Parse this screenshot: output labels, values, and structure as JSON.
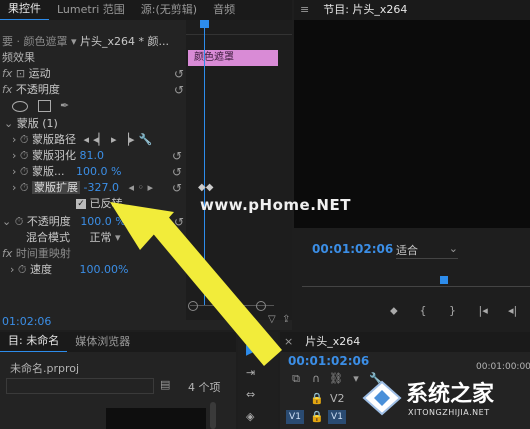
{
  "effect_controls": {
    "tabs": [
      "果控件",
      "Lumetri 范围",
      "源:(无剪辑)",
      "音频"
    ],
    "source_clip": "要 · 颜色遮罩",
    "target_clip": "片头_x264 * 颜...",
    "section_video_effects": "频效果",
    "motion": "运动",
    "opacity": "不透明度",
    "mask_group": "蒙版 (1)",
    "mask_path": "蒙版路径",
    "mask_feather": "蒙版羽化",
    "mask_feather_value": "81.0",
    "mask_opacity": "蒙版...",
    "mask_opacity_value": "100.0 %",
    "mask_expansion": "蒙版扩展",
    "mask_expansion_value": "-327.0",
    "inverted": "已反转",
    "opacity_label": "不透明度",
    "opacity_value": "100.0 %",
    "blend_mode": "混合模式",
    "blend_value": "正常",
    "time_remap": "时间重映射",
    "speed": "速度",
    "speed_value": "100.00%",
    "clip_bar_label": "颜色遮罩",
    "timecode": "01:02:06",
    "fx": "fx"
  },
  "program_monitor": {
    "title": "节目: 片头_x264",
    "timecode": "00:01:02:06",
    "fit": "适合"
  },
  "project": {
    "tabs": [
      "目: 未命名",
      "媒体浏览器"
    ],
    "file": "未命名.prproj",
    "count": "4 个项"
  },
  "timeline": {
    "title": "片头_x264",
    "timecode": "00:01:02:06",
    "ruler_time": "00:01:00:00",
    "tracks": [
      "V2",
      "V1"
    ]
  },
  "watermark": {
    "url": "www.pHome.NET",
    "brand": "系统之家",
    "brand_url": "XITONGZHIJIA.NET"
  },
  "colors": {
    "accent": "#2d8ceb",
    "clip_pink": "#d98bd6",
    "arrow": "#f2ec3a"
  }
}
